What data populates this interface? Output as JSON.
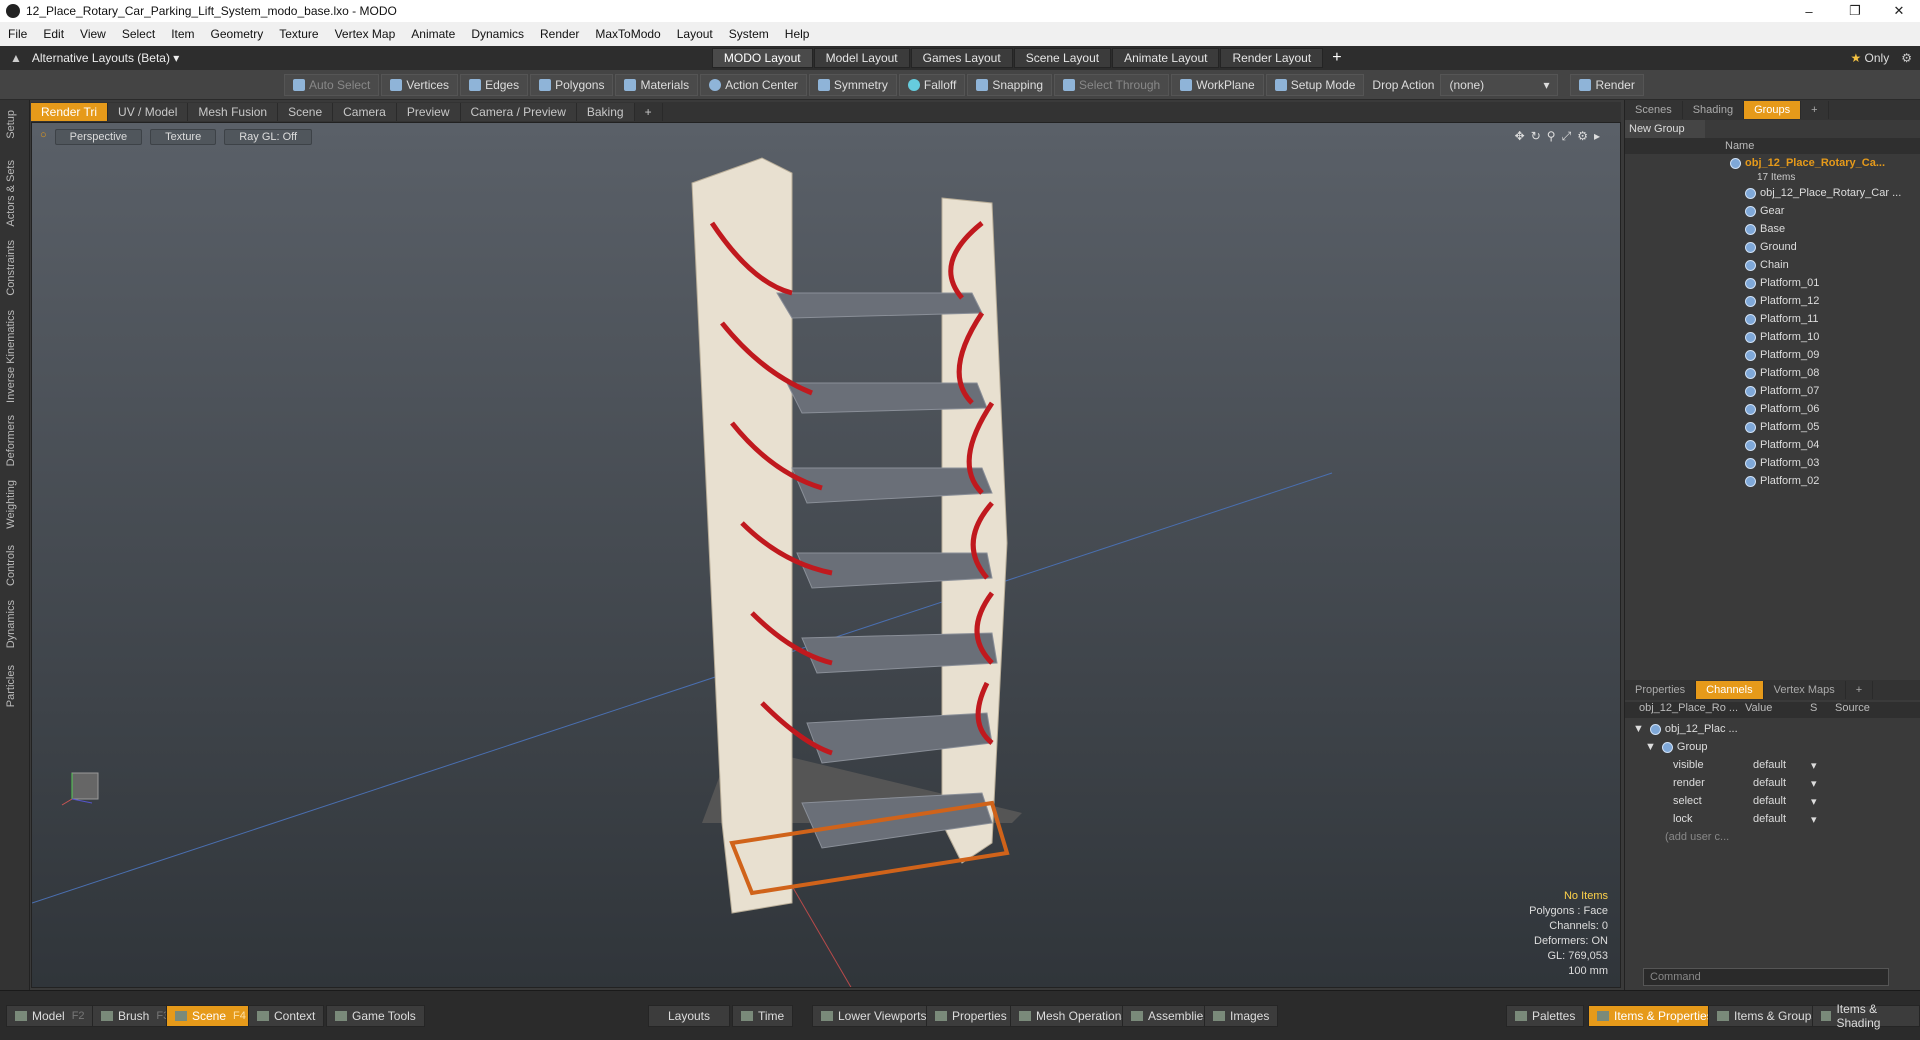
{
  "window": {
    "title": "12_Place_Rotary_Car_Parking_Lift_System_modo_base.lxo - MODO"
  },
  "menu": [
    "File",
    "Edit",
    "View",
    "Select",
    "Item",
    "Geometry",
    "Texture",
    "Vertex Map",
    "Animate",
    "Dynamics",
    "Render",
    "MaxToModo",
    "Layout",
    "System",
    "Help"
  ],
  "layouts": {
    "alt_label": "Alternative Layouts (Beta)",
    "tabs": [
      "MODO Layout",
      "Model Layout",
      "Games Layout",
      "Scene Layout",
      "Animate Layout",
      "Render Layout"
    ],
    "add": "+",
    "only": "Only"
  },
  "toolbar": {
    "items": [
      "Auto Select",
      "Vertices",
      "Edges",
      "Polygons",
      "Materials",
      "Action Center",
      "Symmetry",
      "Falloff",
      "Snapping",
      "Select Through",
      "WorkPlane",
      "Setup Mode",
      "Drop Action"
    ],
    "drop_value": "(none)",
    "render": "Render"
  },
  "viewport_tabs": [
    "Render Tri",
    "UV / Model",
    "Mesh Fusion",
    "Scene",
    "Camera",
    "Preview",
    "Camera / Preview",
    "Baking",
    "+"
  ],
  "left_tabs": [
    "Setup",
    "Actors & Sets",
    "Constraints",
    "Inverse Kinematics",
    "Deformers",
    "Weighting",
    "Controls",
    "Dynamics",
    "Particles"
  ],
  "viewport": {
    "perspective": "Perspective",
    "texture": "Texture",
    "raygl": "Ray GL: Off"
  },
  "stats": {
    "no_items": "No Items",
    "polygons": "Polygons : Face",
    "channels": "Channels: 0",
    "deformers": "Deformers: ON",
    "gl": "GL: 769,053",
    "scale": "100 mm"
  },
  "groups_panel": {
    "tabs": [
      "Scenes",
      "Shading",
      "Groups",
      "+"
    ],
    "new_group": "New Group",
    "name_col": "Name",
    "root": "obj_12_Place_Rotary_Ca...",
    "count": "17 Items",
    "items": [
      "obj_12_Place_Rotary_Car ...",
      "Gear",
      "Base",
      "Ground",
      "Chain",
      "Platform_01",
      "Platform_12",
      "Platform_11",
      "Platform_10",
      "Platform_09",
      "Platform_08",
      "Platform_07",
      "Platform_06",
      "Platform_05",
      "Platform_04",
      "Platform_03",
      "Platform_02"
    ]
  },
  "channels_panel": {
    "tabs": [
      "Properties",
      "Channels",
      "Vertex Maps",
      "+"
    ],
    "header": [
      "obj_12_Place_Ro ...",
      "Value",
      "S",
      "Source"
    ],
    "root": "obj_12_Plac ...",
    "group": "Group",
    "rows": [
      {
        "name": "visible",
        "value": "default"
      },
      {
        "name": "render",
        "value": "default"
      },
      {
        "name": "select",
        "value": "default"
      },
      {
        "name": "lock",
        "value": "default"
      }
    ],
    "add": "(add user c...",
    "command_placeholder": "Command"
  },
  "bottom": {
    "left": [
      {
        "label": "Model",
        "key": "F2"
      },
      {
        "label": "Brush",
        "key": "F3"
      },
      {
        "label": "Scene",
        "key": "F4"
      },
      {
        "label": "Context",
        "key": ""
      },
      {
        "label": "Game Tools",
        "key": ""
      }
    ],
    "center": [
      "Layouts",
      "Time",
      "Lower Viewports",
      "Properties",
      "Mesh Operations",
      "Assemblies",
      "Images"
    ],
    "right": [
      "Palettes",
      "Items & Properties",
      "Items & Groups",
      "Items & Shading"
    ]
  },
  "colors": {
    "accent": "#e69a1a"
  }
}
